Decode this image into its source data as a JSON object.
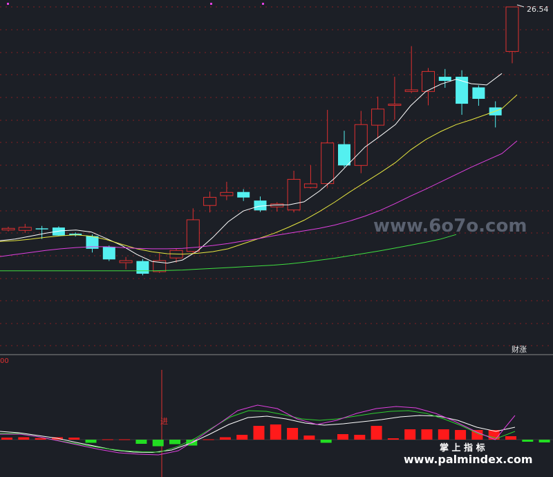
{
  "chart_data": [
    {
      "type": "candlestick",
      "title": "",
      "price_label": "26.54",
      "finance_tag": "财涨",
      "candles": [
        {
          "o": 15.62,
          "h": 15.78,
          "c": 15.7,
          "l": 15.55
        },
        {
          "o": 15.6,
          "h": 15.92,
          "c": 15.75,
          "l": 15.48
        },
        {
          "o": 15.7,
          "h": 15.82,
          "c": 15.65,
          "l": 15.18
        },
        {
          "o": 15.74,
          "h": 15.8,
          "c": 15.35,
          "l": 15.32
        },
        {
          "o": 15.44,
          "h": 15.5,
          "c": 15.36,
          "l": 15.3
        },
        {
          "o": 15.32,
          "h": 15.4,
          "c": 14.7,
          "l": 14.52
        },
        {
          "o": 14.8,
          "h": 14.86,
          "c": 14.18,
          "l": 14.1
        },
        {
          "o": 14.02,
          "h": 14.3,
          "c": 14.12,
          "l": 13.7
        },
        {
          "o": 14.1,
          "h": 14.2,
          "c": 13.48,
          "l": 13.4
        },
        {
          "o": 13.58,
          "h": 14.48,
          "c": 14.12,
          "l": 13.52
        },
        {
          "o": 14.25,
          "h": 14.72,
          "c": 14.62,
          "l": 14.02
        },
        {
          "o": 14.57,
          "h": 16.68,
          "c": 16.12,
          "l": 14.48
        },
        {
          "o": 16.82,
          "h": 17.5,
          "c": 17.22,
          "l": 16.48
        },
        {
          "o": 17.3,
          "h": 17.98,
          "c": 17.46,
          "l": 17.08
        },
        {
          "o": 17.48,
          "h": 17.62,
          "c": 17.21,
          "l": 17.04
        },
        {
          "o": 17.06,
          "h": 17.26,
          "c": 16.58,
          "l": 16.5
        },
        {
          "o": 16.75,
          "h": 16.98,
          "c": 16.9,
          "l": 16.52
        },
        {
          "o": 16.6,
          "h": 18.52,
          "c": 18.1,
          "l": 16.48
        },
        {
          "o": 17.7,
          "h": 18.78,
          "c": 17.88,
          "l": 17.66
        },
        {
          "o": 17.89,
          "h": 21.5,
          "c": 19.88,
          "l": 17.7
        },
        {
          "o": 19.82,
          "h": 20.48,
          "c": 18.78,
          "l": 18.68
        },
        {
          "o": 18.78,
          "h": 21.45,
          "c": 20.78,
          "l": 18.4
        },
        {
          "o": 20.75,
          "h": 22.15,
          "c": 21.54,
          "l": 20.1
        },
        {
          "o": 21.72,
          "h": 23.12,
          "c": 21.78,
          "l": 21.02
        },
        {
          "o": 22.4,
          "h": 24.62,
          "c": 22.48,
          "l": 22.32
        },
        {
          "o": 22.4,
          "h": 23.55,
          "c": 23.38,
          "l": 21.72
        },
        {
          "o": 23.12,
          "h": 23.5,
          "c": 22.92,
          "l": 22.58
        },
        {
          "o": 23.12,
          "h": 23.44,
          "c": 21.8,
          "l": 21.26
        },
        {
          "o": 22.6,
          "h": 22.7,
          "c": 22.04,
          "l": 21.7
        },
        {
          "o": 21.62,
          "h": 21.92,
          "c": 21.23,
          "l": 20.64
        },
        {
          "o": 24.36,
          "h": 26.54,
          "c": 26.54,
          "l": 23.78
        }
      ],
      "ma_lines": [
        {
          "color": "#ffffff",
          "points": [
            15.1,
            15.18,
            15.32,
            15.46,
            15.58,
            15.62,
            15.52,
            15.2,
            14.86,
            14.42,
            14.08,
            14.0,
            14.15,
            14.6,
            15.26,
            16.02,
            16.55,
            16.78,
            16.84,
            16.85,
            17.0,
            17.52,
            18.15,
            18.92,
            19.68,
            20.22,
            20.78,
            21.7,
            22.4,
            22.76,
            23.0,
            22.78,
            22.72,
            23.28
          ]
        },
        {
          "color": "#e8e840",
          "points": [
            15.06,
            15.1,
            15.17,
            15.26,
            15.34,
            15.38,
            15.32,
            15.15,
            14.92,
            14.7,
            14.55,
            14.46,
            14.44,
            14.48,
            14.56,
            14.7,
            14.95,
            15.2,
            15.45,
            15.76,
            16.1,
            16.52,
            16.98,
            17.48,
            17.95,
            18.42,
            18.92,
            19.54,
            20.05,
            20.45,
            20.78,
            21.02,
            21.28,
            21.56,
            22.24
          ]
        },
        {
          "color": "#e040e0",
          "points": [
            14.32,
            14.42,
            14.52,
            14.62,
            14.7,
            14.76,
            14.8,
            14.8,
            14.76,
            14.72,
            14.7,
            14.7,
            14.72,
            14.78,
            14.86,
            14.96,
            15.08,
            15.2,
            15.34,
            15.46,
            15.58,
            15.7,
            15.86,
            16.06,
            16.3,
            16.58,
            16.92,
            17.28,
            17.62,
            17.98,
            18.34,
            18.7,
            19.03,
            19.36,
            19.98
          ]
        },
        {
          "color": "#40e040",
          "points": [
            13.62,
            13.62,
            13.62,
            13.62,
            13.62,
            13.62,
            13.62,
            13.62,
            13.62,
            13.62,
            13.62,
            13.64,
            13.66,
            13.7,
            13.74,
            13.78,
            13.82,
            13.86,
            13.9,
            13.96,
            14.04,
            14.14,
            14.24,
            14.36,
            14.48,
            14.6,
            14.74,
            14.88,
            15.02,
            15.18,
            15.4
          ]
        }
      ],
      "watermark": "www.6o7o.com"
    },
    {
      "type": "bar",
      "title": "",
      "corner_label": "00",
      "signal_label": "进",
      "macd_bars": [
        0.3,
        0.35,
        0.22,
        0.35,
        0.3,
        -0.45,
        0.05,
        0.05,
        -0.6,
        -0.95,
        -0.65,
        -0.85,
        0.05,
        0.35,
        0.7,
        2.0,
        2.2,
        1.7,
        0.6,
        -0.45,
        0.8,
        0.7,
        2.0,
        0.2,
        1.5,
        1.5,
        1.5,
        1.4,
        1.4,
        1.4,
        0.5,
        -0.3,
        -0.4,
        -0.85,
        3.4
      ],
      "line_white": [
        1.2,
        1.0,
        0.6,
        0.2,
        -0.4,
        -0.95,
        -1.5,
        -1.8,
        -1.85,
        -1.5,
        -0.5,
        0.8,
        2.2,
        3.2,
        3.4,
        3.0,
        2.4,
        2.1,
        2.3,
        2.6,
        2.9,
        3.3,
        3.5,
        3.4,
        2.8,
        1.8,
        1.2,
        1.8
      ],
      "line_green": [
        0.9,
        0.9,
        0.5,
        0.0,
        -0.45,
        -0.9,
        -1.3,
        -1.6,
        -1.75,
        -1.8,
        -1.0,
        0.2,
        1.8,
        3.3,
        4.2,
        4.1,
        3.6,
        3.0,
        2.8,
        3.0,
        3.4,
        3.8,
        4.1,
        4.2,
        3.8,
        3.0,
        2.0,
        0.8,
        0.2,
        1.2
      ],
      "line_magenta": [
        0.8,
        0.8,
        0.4,
        -0.2,
        -0.8,
        -1.4,
        -1.9,
        -2.1,
        -2.2,
        -1.6,
        0.2,
        2.2,
        4.2,
        5.0,
        4.5,
        3.0,
        2.2,
        2.8,
        3.8,
        4.5,
        4.8,
        4.6,
        3.8,
        2.6,
        1.2,
        0.0,
        3.5
      ]
    }
  ],
  "ui": {
    "watermark_bottom": "www.palmindex.com",
    "watermark_cn": "掌 上 指 标"
  },
  "colors": {
    "up": "#e03030",
    "down": "#54f0f0",
    "bg": "#1c1f26",
    "grid": "#b02020"
  }
}
